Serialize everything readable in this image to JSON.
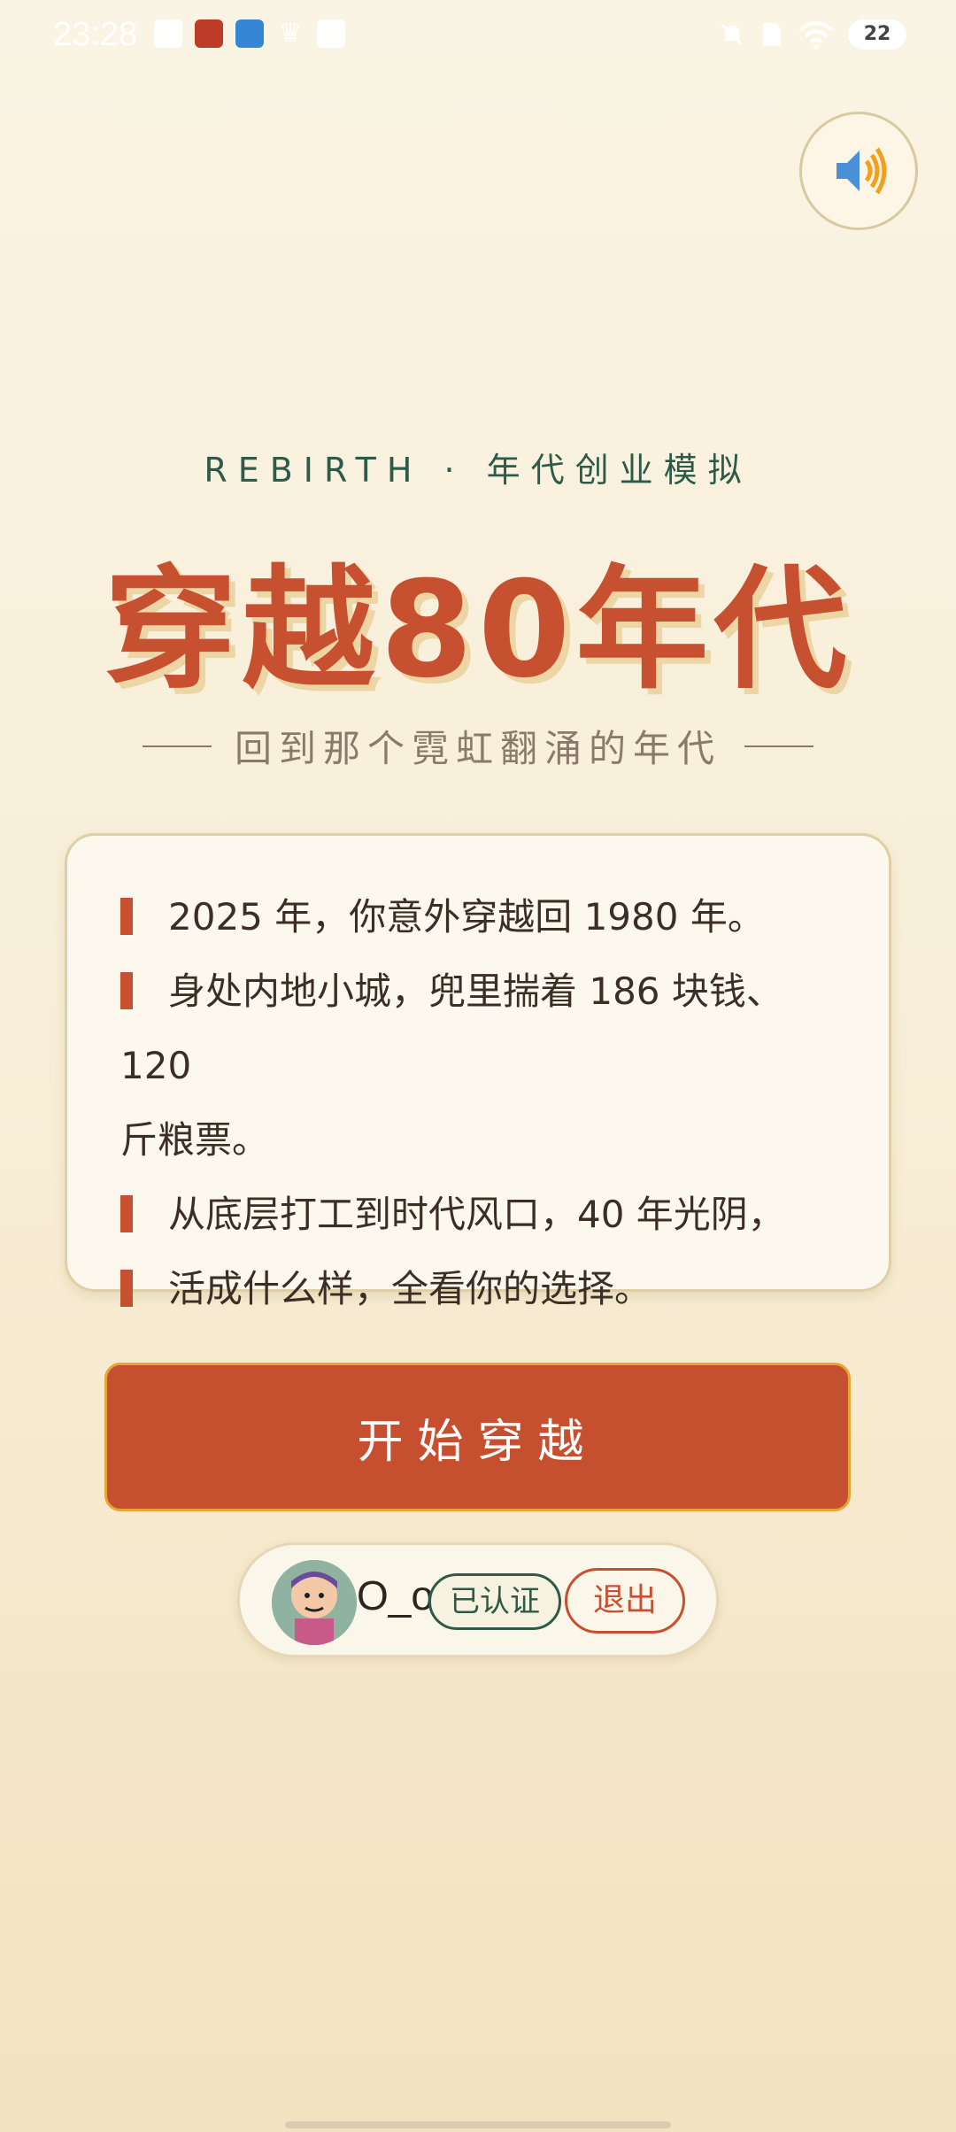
{
  "status_bar": {
    "time": "23:28",
    "battery": "22",
    "left_icons": [
      "message-icon",
      "game-icon",
      "video-app-icon",
      "crown-icon",
      "notes-icon"
    ],
    "right_icons": [
      "silent-icon",
      "sim-icon",
      "wifi-icon",
      "battery-icon"
    ]
  },
  "sound_button": {
    "icon": "speaker-icon"
  },
  "header": {
    "overline": "REBIRTH  ·  年代创业模拟",
    "title": "穿越80年代",
    "tagline": "回到那个霓虹翻涌的年代"
  },
  "intro": {
    "lines": [
      "2025 年，你意外穿越回 1980 年。",
      "身处内地小城，兜里揣着 186 块钱、120",
      "斤粮票。",
      "从底层打工到时代风口，40 年光阴，",
      "活成什么样，全看你的选择。"
    ]
  },
  "start_button": {
    "label": "开始穿越"
  },
  "user": {
    "name": "O_o",
    "verified_label": "已认证",
    "logout_label": "退出"
  },
  "colors": {
    "accent": "#c6502f",
    "green": "#2e5a4a",
    "background": "#f8eed7",
    "border": "#e7a534"
  }
}
